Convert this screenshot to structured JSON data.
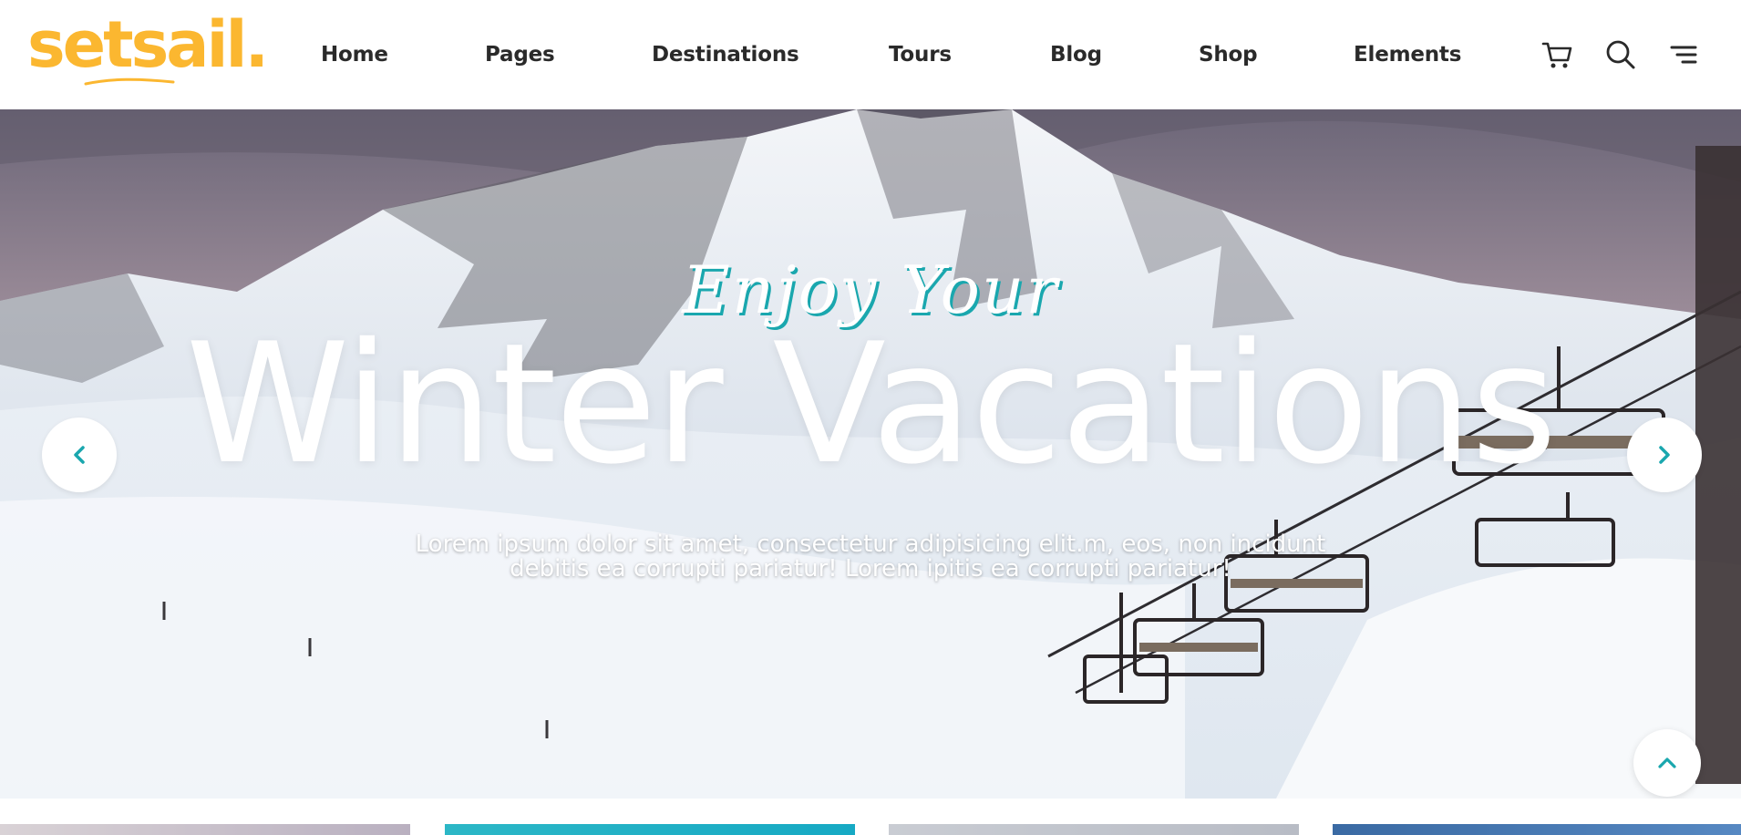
{
  "brand": {
    "logo_text": "setsail."
  },
  "nav": {
    "items": [
      {
        "label": "Home"
      },
      {
        "label": "Pages"
      },
      {
        "label": "Destinations"
      },
      {
        "label": "Tours"
      },
      {
        "label": "Blog"
      },
      {
        "label": "Shop"
      },
      {
        "label": "Elements"
      }
    ]
  },
  "header_icons": [
    "cart-icon",
    "search-icon",
    "menu-icon"
  ],
  "hero": {
    "script_heading": "Enjoy Your",
    "title": "Winter Vacations",
    "description_line1": "Lorem ipsum dolor sit amet, consectetur adipisicing elit.m, eos, non incidunt",
    "description_line2": "debitis ea corrupti pariatur! Lorem ipitis ea corrupti pariatur!",
    "controls": [
      "chevron-left-icon",
      "chevron-right-icon",
      "chevron-up-icon"
    ]
  },
  "colors": {
    "brand": "#fbb730",
    "accent": "#1aa7ae",
    "nav_text": "#2a2a2a"
  }
}
